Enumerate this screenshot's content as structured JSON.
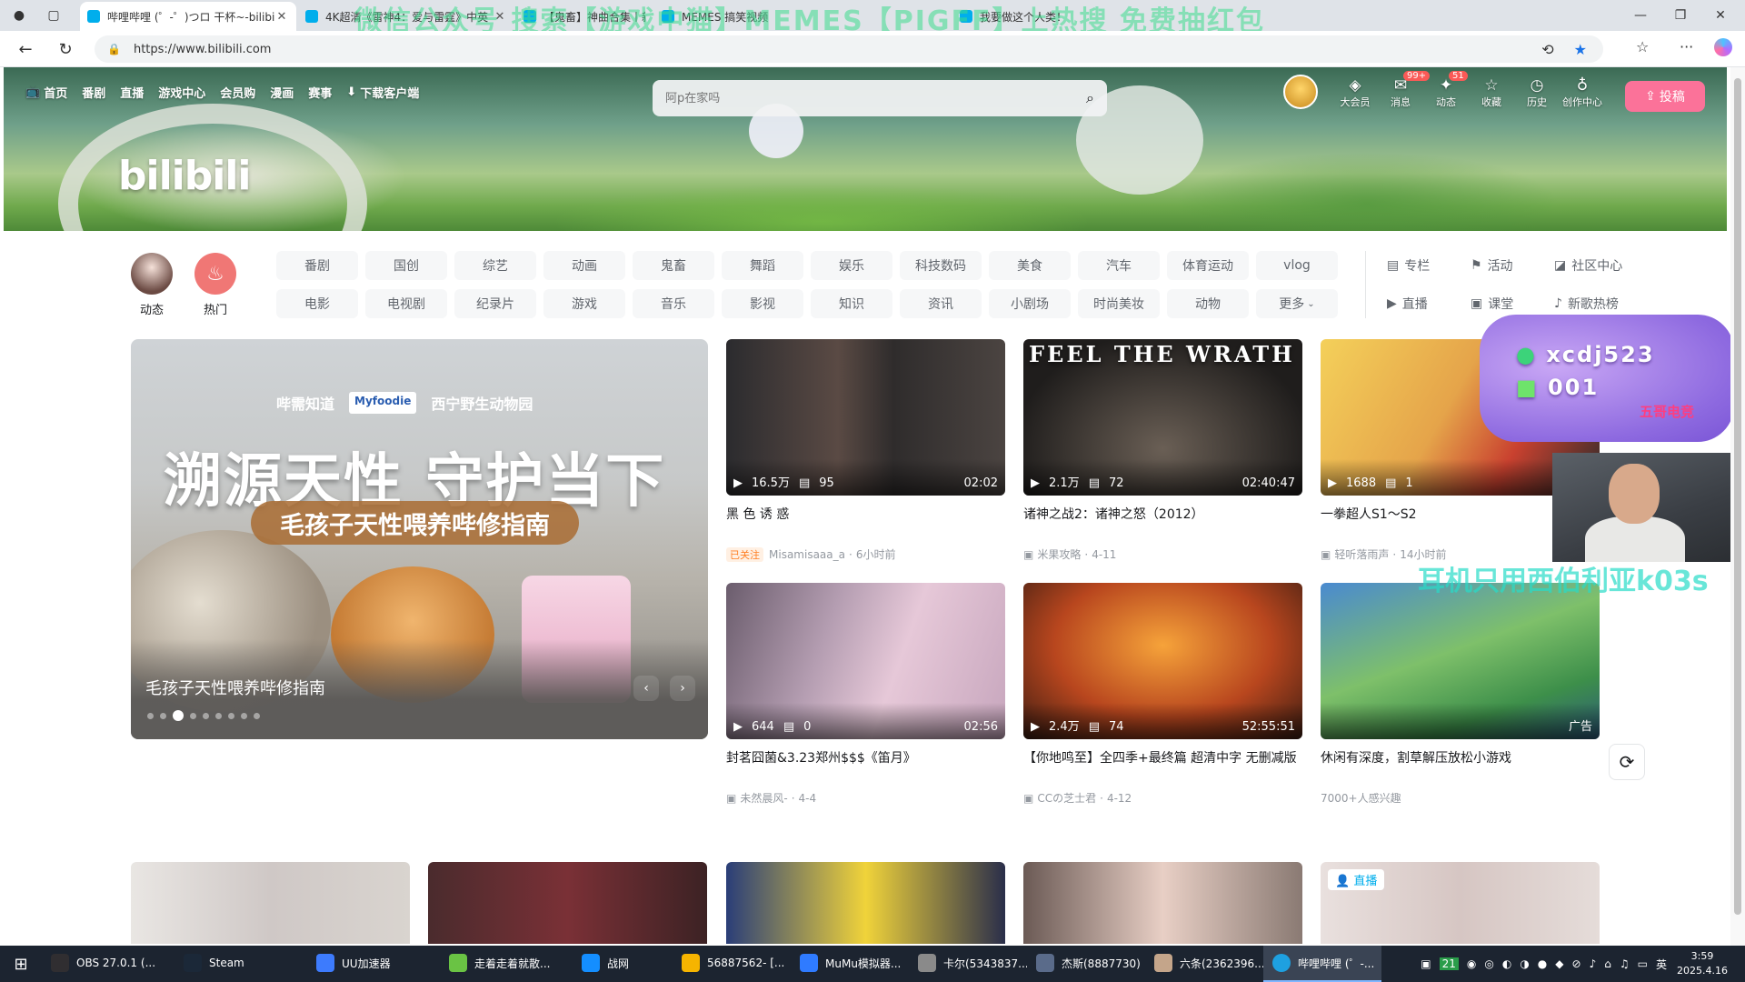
{
  "browser": {
    "tabs": [
      {
        "title": "哔哩哔哩 (゜-゜)つロ 干杯~-bilibili",
        "active": true
      },
      {
        "title": "4K超清《雷神4：爱与雷霆》中英",
        "active": false
      },
      {
        "title": "【鬼畜】神曲合集丨新鬼畜",
        "active": false
      },
      {
        "title": "MEMES 搞笑视频",
        "active": false
      },
      {
        "title": "我要做这个人类！",
        "active": false
      }
    ],
    "url": "https://www.bilibili.com",
    "overlay_text": "微信公众号 搜索【游戏中猫】MEMES【PIGFF】上热搜 免费抽红包",
    "colors": {
      "accent": "#00aeec",
      "pink": "#fb7299"
    }
  },
  "header": {
    "nav": [
      "首页",
      "番剧",
      "直播",
      "游戏中心",
      "会员购",
      "漫画",
      "赛事",
      "下载客户端"
    ],
    "logo": "bilibili",
    "search_placeholder": "阿p在家吗",
    "entries": [
      {
        "label": "大会员",
        "icon": "vip-icon",
        "badge": ""
      },
      {
        "label": "消息",
        "icon": "message-icon",
        "badge": "99+"
      },
      {
        "label": "动态",
        "icon": "dynamic-icon",
        "badge": "51"
      },
      {
        "label": "收藏",
        "icon": "star-icon",
        "badge": ""
      },
      {
        "label": "历史",
        "icon": "clock-icon",
        "badge": ""
      },
      {
        "label": "创作中心",
        "icon": "bulb-icon",
        "badge": ""
      }
    ],
    "upload_label": "投稿"
  },
  "channels": {
    "left": [
      {
        "label": "动态"
      },
      {
        "label": "热门"
      }
    ],
    "grid": [
      "番剧",
      "国创",
      "综艺",
      "动画",
      "鬼畜",
      "舞蹈",
      "娱乐",
      "科技数码",
      "美食",
      "汽车",
      "体育运动",
      "vlog",
      "电影",
      "电视剧",
      "纪录片",
      "游戏",
      "音乐",
      "影视",
      "知识",
      "资讯",
      "小剧场",
      "时尚美妆",
      "动物",
      "更多"
    ],
    "side": [
      "专栏",
      "活动",
      "社区中心",
      "直播",
      "课堂",
      "新歌热榜"
    ]
  },
  "carousel": {
    "brands": [
      "哔需知道",
      "Myfoodie",
      "西宁野生动物园"
    ],
    "headline": "溯源天性 守护当下",
    "subline": "毛孩子天性喂养哔修指南",
    "title": "毛孩子天性喂养哔修指南",
    "dots": 9,
    "active_dot": 2
  },
  "videos": [
    {
      "thumb_text": "",
      "views": "16.5万",
      "danmaku": "95",
      "duration": "02:02",
      "title": "黑 色 诱 惑",
      "followed": "已关注",
      "author": "Misamisaaa_a",
      "date": "6小时前"
    },
    {
      "thumb_text": "FEEL THE WRATH",
      "views": "2.1万",
      "danmaku": "72",
      "duration": "02:40:47",
      "title": "诸神之战2：诸神之怒（2012）",
      "followed": "",
      "author": "米果攻略",
      "date": "4-11"
    },
    {
      "thumb_text": "",
      "views": "1688",
      "danmaku": "1",
      "duration": "",
      "title": "一拳超人S1～S2",
      "followed": "",
      "author": "轻听落雨声",
      "date": "14小时前"
    },
    {
      "thumb_text": "",
      "views": "644",
      "danmaku": "0",
      "duration": "02:56",
      "title": "封茗囧菌&3.23郑州$$$《笛月》",
      "followed": "",
      "author": "未然晨风-",
      "date": "4-4"
    },
    {
      "thumb_text": "",
      "views": "2.4万",
      "danmaku": "74",
      "duration": "52:55:51",
      "title": "【你地鸣至】全四季+最终篇 超清中字 无删减版",
      "followed": "",
      "author": "CCの芝士君",
      "date": "4-12"
    },
    {
      "thumb_text": "",
      "views": "",
      "danmaku": "",
      "duration": "广告",
      "title": "休闲有深度，割草解压放松小游戏",
      "followed": "",
      "author": "7000+人感兴趣",
      "date": ""
    }
  ],
  "second_row": {
    "live_label": "直播"
  },
  "stream_overlay": {
    "id": "xcdj523",
    "num": "001",
    "tag": "五哥电竞",
    "green_text": "耳机只用西伯利亚k03s"
  },
  "taskbar": {
    "items": [
      {
        "label": "OBS 27.0.1 (...",
        "color": "#302e31"
      },
      {
        "label": "Steam",
        "color": "#1b2838"
      },
      {
        "label": "UU加速器",
        "color": "#3d7bfd"
      },
      {
        "label": "走着走着就散...",
        "color": "#6ac344"
      },
      {
        "label": "战网",
        "color": "#148eff"
      },
      {
        "label": "56887562- [...",
        "color": "#f6b400"
      },
      {
        "label": "MuMu模拟器...",
        "color": "#2f7bff"
      },
      {
        "label": "卡尔(5343837...",
        "color": "#8a8a8a"
      },
      {
        "label": "杰斯(8887730)",
        "color": "#5a6b8a"
      },
      {
        "label": "六条(2362396...",
        "color": "#c4a58a"
      },
      {
        "label": "哔哩哔哩 (゜-...",
        "color": "#1ea0e0"
      }
    ],
    "tray_lang": "英",
    "tray_num": "21",
    "time": "3:59",
    "date": "2025.4.16"
  }
}
